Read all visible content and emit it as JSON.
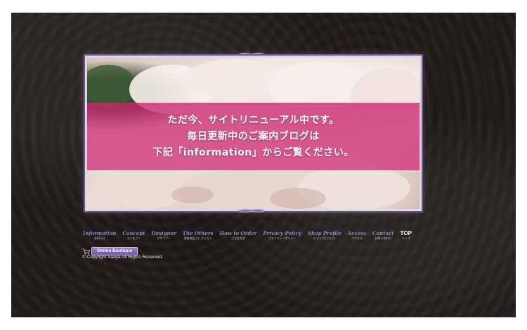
{
  "banner": {
    "line1": "ただ今、サイトリニューアル中です。",
    "line2": "毎日更新中のご案内ブログは",
    "line3": "下記「information」からご覧ください。"
  },
  "nav": [
    {
      "en": "Information",
      "jp": "お知らせ"
    },
    {
      "en": "Concept",
      "jp": "コンセプト"
    },
    {
      "en": "Designer",
      "jp": "デザイナー"
    },
    {
      "en": "The Others",
      "jp": "取扱商品コレクション"
    },
    {
      "en": "How to Order",
      "jp": "ご注文方法"
    },
    {
      "en": "Privacy Policy",
      "jp": "プライバシーポリシー"
    },
    {
      "en": "Shop Profile",
      "jp": "ショップについて"
    },
    {
      "en": "Access",
      "jp": "アクセス"
    },
    {
      "en": "Contact",
      "jp": "お問い合わせ"
    },
    {
      "en": "TOP",
      "jp": "トップ"
    }
  ],
  "boutique": {
    "label": "Online Boutique"
  },
  "copyright": "© Copyright Saaya All Rights Reserved.",
  "colors": {
    "banner": "#c8286e",
    "nav_text": "#8d82b6",
    "background": "#1f1a17"
  }
}
